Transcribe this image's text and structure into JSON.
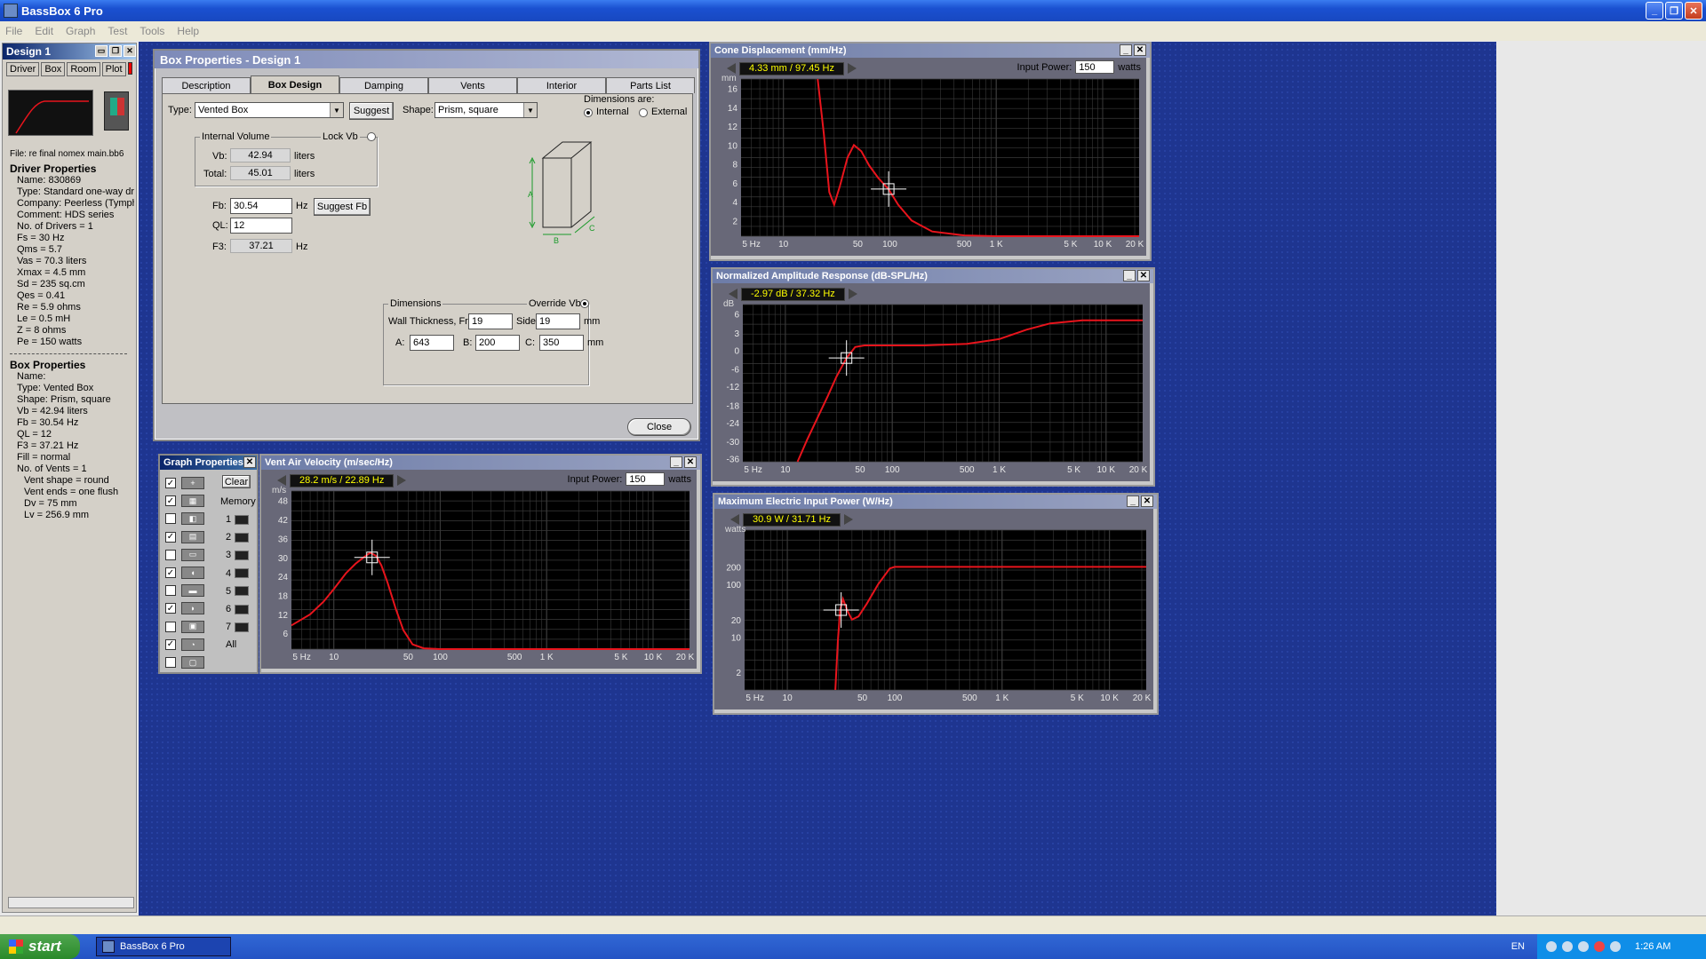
{
  "app": {
    "title": "BassBox 6 Pro",
    "menu": [
      "File",
      "Edit",
      "Graph",
      "Test",
      "Tools",
      "Help"
    ]
  },
  "design": {
    "title": "Design 1",
    "tabs": [
      "Driver",
      "Box",
      "Room",
      "Plot"
    ],
    "file": "File: re final nomex main.bb6",
    "driver_header": "Driver Properties",
    "driver": [
      "Name: 830869",
      "Type: Standard one-way driver",
      "Company: Peerless (Tymphany)",
      "Comment: HDS series",
      "No. of Drivers = 1",
      "Fs = 30 Hz",
      "Qms = 5.7",
      "Vas = 70.3 liters",
      "Xmax = 4.5 mm",
      "Sd = 235 sq.cm",
      "Qes = 0.41",
      "Re = 5.9 ohms",
      "Le = 0.5 mH",
      "Z = 8 ohms",
      "Pe = 150 watts"
    ],
    "box_header": "Box Properties",
    "box": [
      "Name:",
      "Type: Vented Box",
      "Shape: Prism, square",
      "Vb = 42.94 liters",
      "Fb = 30.54 Hz",
      "QL = 12",
      "F3 = 37.21 Hz",
      "Fill = normal",
      "No. of Vents = 1"
    ],
    "vent": [
      "Vent shape = round",
      "Vent ends = one flush",
      "Dv = 75 mm",
      "Lv = 256.9 mm"
    ]
  },
  "boxprops": {
    "title": "Box Properties - Design 1",
    "tabs": [
      "Description",
      "Box Design",
      "Damping",
      "Vents",
      "Interior",
      "Parts List"
    ],
    "type_label": "Type:",
    "type_value": "Vented Box",
    "suggest": "Suggest",
    "shape_label": "Shape:",
    "shape_value": "Prism, square",
    "dims_are": "Dimensions are:",
    "internal": "Internal",
    "external": "External",
    "internal_volume": "Internal Volume",
    "lock_vb": "Lock Vb",
    "vb_label": "Vb:",
    "vb": "42.94",
    "total_label": "Total:",
    "total": "45.01",
    "liters": "liters",
    "fb_label": "Fb:",
    "fb": "30.54",
    "hz": "Hz",
    "suggest_fb": "Suggest Fb",
    "ql_label": "QL:",
    "ql": "12",
    "f3_label": "F3:",
    "f3": "37.21",
    "dimensions": "Dimensions",
    "override_vb": "Override Vb",
    "wall_front": "Wall Thickness, Front:",
    "front": "19",
    "side_label": "Side:",
    "side": "19",
    "mm": "mm",
    "a_label": "A:",
    "a": "643",
    "b_label": "B:",
    "b": "200",
    "c_label": "C:",
    "c": "350",
    "close": "Close",
    "diag": {
      "a": "A",
      "b": "B",
      "c": "C"
    }
  },
  "graphs": {
    "cone": {
      "title": "Cone Displacement (mm/Hz)",
      "readout": "4.33 mm / 97.45 Hz",
      "input_power_label": "Input Power:",
      "input_power": "150",
      "watts": "watts",
      "unit": "mm",
      "yticks": [
        "16",
        "14",
        "12",
        "10",
        "8",
        "6",
        "4",
        "2"
      ],
      "xticks": [
        "5 Hz",
        "10",
        "50",
        "100",
        "500",
        "1 K",
        "5 K",
        "10 K",
        "20 K"
      ]
    },
    "amp": {
      "title": "Normalized Amplitude Response (dB-SPL/Hz)",
      "readout": "-2.97 dB / 37.32 Hz",
      "unit": "dB",
      "yticks": [
        "6",
        "3",
        "0",
        "-6",
        "-12",
        "-18",
        "-24",
        "-30",
        "-36"
      ],
      "xticks": [
        "5 Hz",
        "10",
        "50",
        "100",
        "500",
        "1 K",
        "5 K",
        "10 K",
        "20 K"
      ]
    },
    "power": {
      "title": "Maximum Electric Input Power (W/Hz)",
      "readout": "30.9 W / 31.71 Hz",
      "unit": "watts",
      "yticks": [
        "200",
        "100",
        "20",
        "10",
        "2"
      ],
      "xticks": [
        "5 Hz",
        "10",
        "50",
        "100",
        "500",
        "1 K",
        "5 K",
        "10 K",
        "20 K"
      ]
    },
    "vent": {
      "title": "Vent Air Velocity (m/sec/Hz)",
      "readout": "28.2 m/s / 22.89 Hz",
      "input_power_label": "Input Power:",
      "input_power": "150",
      "watts": "watts",
      "unit": "m/s",
      "yticks": [
        "48",
        "42",
        "36",
        "30",
        "24",
        "18",
        "12",
        "6"
      ],
      "xticks": [
        "5 Hz",
        "10",
        "50",
        "100",
        "500",
        "1 K",
        "5 K",
        "10 K",
        "20 K"
      ]
    }
  },
  "gprops": {
    "title": "Graph Properties",
    "clear": "Clear",
    "memory": "Memory",
    "mems": [
      "1",
      "2",
      "3",
      "4",
      "5",
      "6",
      "7",
      "All"
    ],
    "checks": [
      true,
      true,
      false,
      true,
      false,
      true,
      false,
      true,
      false,
      true,
      false
    ]
  },
  "taskbar": {
    "start": "start",
    "item": "BassBox 6 Pro",
    "lang": "EN",
    "time": "1:26 AM"
  },
  "colors": {
    "curve": "#e8141c",
    "grid": "#3a3a3a",
    "plot_bg": "#000000",
    "desktop": "#1e3590"
  }
}
